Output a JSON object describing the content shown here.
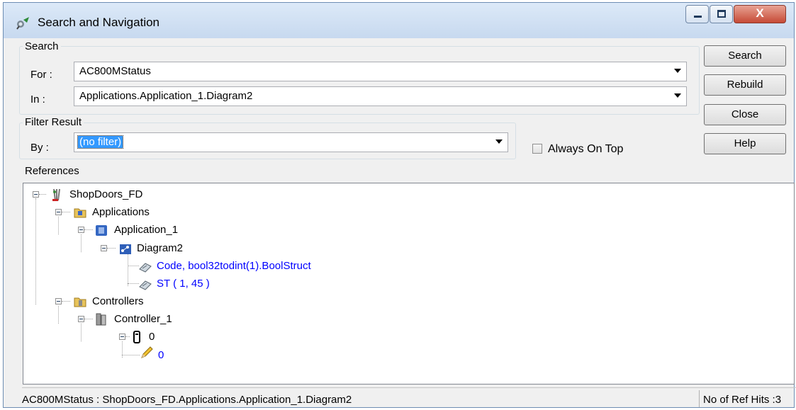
{
  "window": {
    "title": "Search and Navigation",
    "close_glyph": "X"
  },
  "search": {
    "group_label": "Search",
    "for_label": "For :",
    "for_value": "AC800MStatus",
    "in_label": "In :",
    "in_value": "Applications.Application_1.Diagram2"
  },
  "filter": {
    "group_label": "Filter Result",
    "by_label": "By :",
    "by_value": "(no filter)"
  },
  "buttons": {
    "search": "Search",
    "rebuild": "Rebuild",
    "close": "Close",
    "help": "Help"
  },
  "always_on_top": {
    "label": "Always On Top",
    "checked": false
  },
  "references": {
    "label": "References",
    "tree": [
      {
        "label": "ShopDoors_FD",
        "icon": "project-icon"
      },
      {
        "label": "Applications",
        "icon": "applications-folder-icon"
      },
      {
        "label": "Application_1",
        "icon": "application-icon"
      },
      {
        "label": "Diagram2",
        "icon": "diagram-icon"
      },
      {
        "label": "Code, bool32todint(1).BoolStruct",
        "icon": "reference-icon"
      },
      {
        "label": "ST ( 1, 45 )",
        "icon": "reference-icon"
      },
      {
        "label": "Controllers",
        "icon": "controllers-folder-icon"
      },
      {
        "label": "Controller_1",
        "icon": "controller-icon"
      },
      {
        "label": "0",
        "icon": "hardware-unit-icon"
      },
      {
        "label": "0",
        "icon": "pencil-icon"
      }
    ]
  },
  "status": {
    "path": "AC800MStatus : ShopDoors_FD.Applications.Application_1.Diagram2",
    "hits": "No of Ref Hits :3"
  },
  "colors": {
    "link": "#0000ff",
    "selection": "#3399ff",
    "close_button": "#c64a36"
  }
}
